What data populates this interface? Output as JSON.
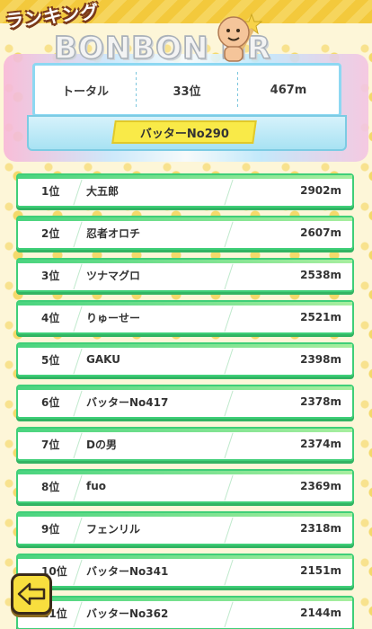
{
  "header": {
    "section_label": "ランキング",
    "logo_text": "BONBON HR",
    "total_label": "トータル",
    "total_rank": "33位",
    "total_distance": "467m",
    "player_name": "バッターNo290"
  },
  "rankings": [
    {
      "rank": "1位",
      "name": "大五郎",
      "distance": "2902m"
    },
    {
      "rank": "2位",
      "name": "忍者オロチ",
      "distance": "2607m"
    },
    {
      "rank": "3位",
      "name": "ツナマグロ",
      "distance": "2538m"
    },
    {
      "rank": "4位",
      "name": "りゅーせー",
      "distance": "2521m"
    },
    {
      "rank": "5位",
      "name": "GAKU",
      "distance": "2398m"
    },
    {
      "rank": "6位",
      "name": "バッターNo417",
      "distance": "2378m"
    },
    {
      "rank": "7位",
      "name": "Dの男",
      "distance": "2374m"
    },
    {
      "rank": "8位",
      "name": "fuo",
      "distance": "2369m"
    },
    {
      "rank": "9位",
      "name": "フェンリル",
      "distance": "2318m"
    },
    {
      "rank": "10位",
      "name": "バッターNo341",
      "distance": "2151m"
    },
    {
      "rank": "11位",
      "name": "バッターNo362",
      "distance": "2144m"
    }
  ],
  "icons": {
    "back": "arrow-left-icon",
    "mascot": "mascot-bat-icon"
  },
  "colors": {
    "row_border": "#3fcf78",
    "badge": "#f9ea48",
    "panel_border": "#8dd8f2",
    "back_button": "#f8de3e"
  }
}
